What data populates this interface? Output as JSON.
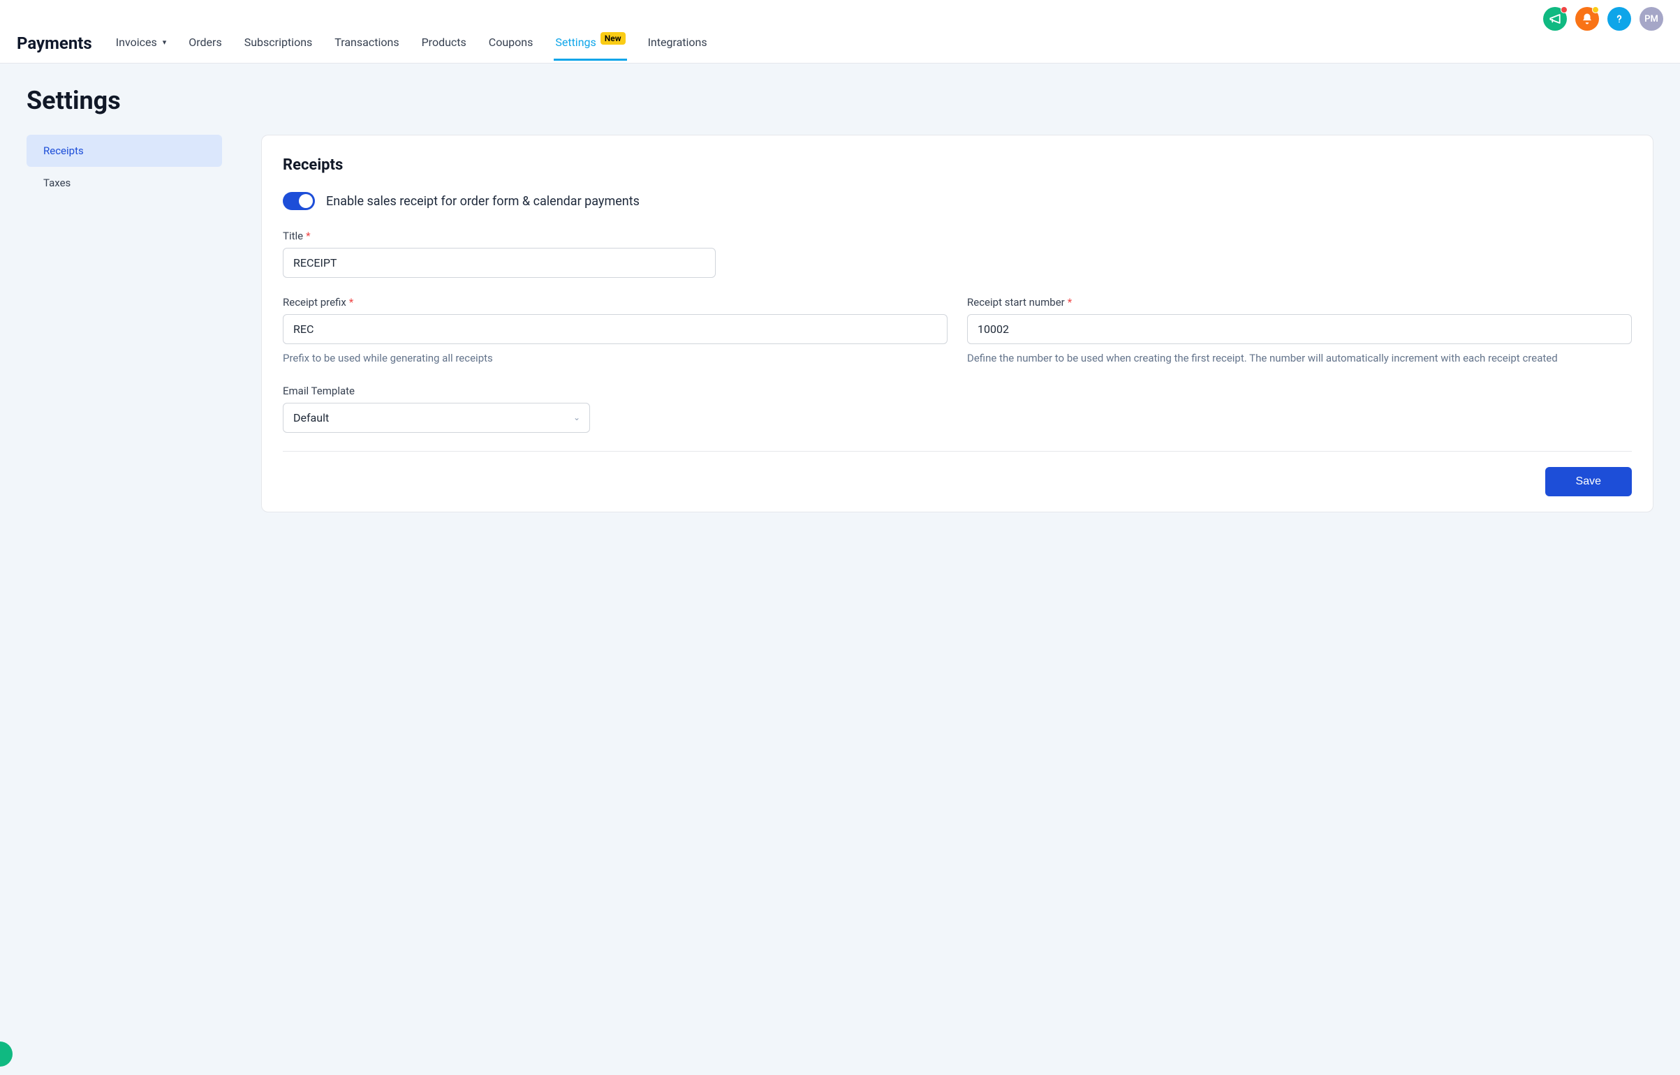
{
  "header": {
    "brand": "Payments",
    "avatar_initials": "PM",
    "nav": [
      {
        "label": "Invoices",
        "has_chevron": true
      },
      {
        "label": "Orders"
      },
      {
        "label": "Subscriptions"
      },
      {
        "label": "Transactions"
      },
      {
        "label": "Products"
      },
      {
        "label": "Coupons"
      },
      {
        "label": "Settings",
        "active": true,
        "badge": "New"
      },
      {
        "label": "Integrations"
      }
    ]
  },
  "page": {
    "title": "Settings"
  },
  "sidebar": {
    "items": [
      {
        "label": "Receipts",
        "active": true
      },
      {
        "label": "Taxes"
      }
    ]
  },
  "card": {
    "title": "Receipts",
    "toggle_label": "Enable sales receipt for order form & calendar payments",
    "save_label": "Save",
    "fields": {
      "title": {
        "label": "Title",
        "value": "RECEIPT"
      },
      "prefix": {
        "label": "Receipt prefix",
        "value": "REC",
        "help": "Prefix to be used while generating all receipts"
      },
      "start_number": {
        "label": "Receipt start number",
        "value": "10002",
        "help": "Define the number to be used when creating the first receipt. The number will automatically increment with each receipt created"
      },
      "email_template": {
        "label": "Email Template",
        "value": "Default"
      }
    }
  }
}
